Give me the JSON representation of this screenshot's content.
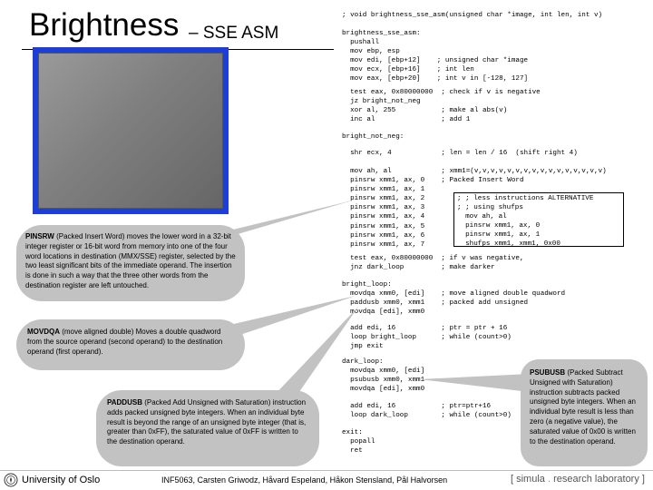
{
  "slide": {
    "title_main": "Brightness",
    "title_sub": "– SSE ASM"
  },
  "code": {
    "signature": "; void brightness_sse_asm(unsigned char *image, int len, int v)",
    "prologue": "brightness_sse_asm:\n  pushall\n  mov ebp, esp\n  mov edi, [ebp+12]    ; unsigned char *image\n  mov ecx, [ebp+16]    ; int len\n  mov eax, [ebp+20]    ; int v in [-128, 127]",
    "neg_check": "  test eax, 0x80000000  ; check if v is negative\n  jz bright_not_neg\n  xor al, 255           ; make al abs(v)\n  inc al                ; add 1",
    "label_not_neg": "bright_not_neg:",
    "shr_line": "  shr ecx, 4            ; len = len / 16  (shift right 4)",
    "pinsrw_block": "  mov ah, al            ; xmm1=(v,v,v,v,v,v,v,v,v,v,v,v,v,v,v,v)\n  pinsrw xmm1, ax, 0    ; Packed Insert Word\n  pinsrw xmm1, ax, 1\n  pinsrw xmm1, ax, 2\n  pinsrw xmm1, ax, 3\n  pinsrw xmm1, ax, 4\n  pinsrw xmm1, ax, 5\n  pinsrw xmm1, ax, 6\n  pinsrw xmm1, ax, 7",
    "alternative": "; ; less instructions ALTERNATIVE\n; ; using shufps\n  mov ah, al\n  pinsrw xmm1, ax, 0\n  pinsrw xmm1, ax, 1\n  shufps xmm1, xmm1, 0x00",
    "neg_test": "  test eax, 0x80000000  ; if v was negative,\n  jnz dark_loop         ; make darker",
    "bright_loop": "bright_loop:\n  movdqa xmm0, [edi]    ; move aligned double quadword\n  paddusb xmm0, xmm1    ; packed add unsigned\n  movdqa [edi], xmm0",
    "bright_tail": "  add edi, 16           ; ptr = ptr + 16\n  loop bright_loop      ; while (count>0)\n  jmp exit",
    "dark_loop": "dark_loop:\n  movdqa xmm0, [edi]\n  psubusb xmm0, xmm1\n  movdqa [edi], xmm0",
    "dark_tail": "  add edi, 16           ; ptr=ptr+16\n  loop dark_loop        ; while (count>0)",
    "exit": "exit:\n  popall\n  ret"
  },
  "callouts": {
    "pinsrw_term": "PINSRW",
    "pinsrw_text": " (Packed Insert Word) moves the lower word in a 32-bit integer register or 16-bit word from memory into one of the four word locations in destination (MMX/SSE) register, selected by the two least significant bits of the immediate operand. The insertion is done in such a way that the three other words from the destination register are left untouched.",
    "movdqa_term": "MOVDQA",
    "movdqa_text": " (move aligned double) Moves a double quadword from the source operand (second operand) to the destination operand (first operand).",
    "paddusb_term": "PADDUSB",
    "paddusb_text": " (Packed Add Unsigned with Saturation) instruction adds packed unsigned byte integers. When an individual byte result is beyond the range of an unsigned byte integer (that is, greater than 0xFF), the saturated value of 0xFF is written to the destination operand.",
    "psubusb_term": "PSUBUSB",
    "psubusb_text": " (Packed Subtract Unsigned with Saturation) instruction subtracts packed unsigned byte integers. When an individual byte result is less than zero (a negative value), the saturated value of 0x00 is written to the destination operand."
  },
  "footer": {
    "university": "University of Oslo",
    "course": "INF5063, Carsten Griwodz, Håvard Espeland, Håkon Stensland, Pål Halvorsen",
    "simula_open": "[ simula",
    "simula_dot": " . ",
    "simula_close": "research laboratory ]"
  },
  "colors": {
    "image_frame": "#1f3fd4",
    "callout_bg": "#c2c2c2",
    "simula_accent": "#e07b00"
  },
  "icons": {
    "uio_seal": "university-seal-icon"
  }
}
